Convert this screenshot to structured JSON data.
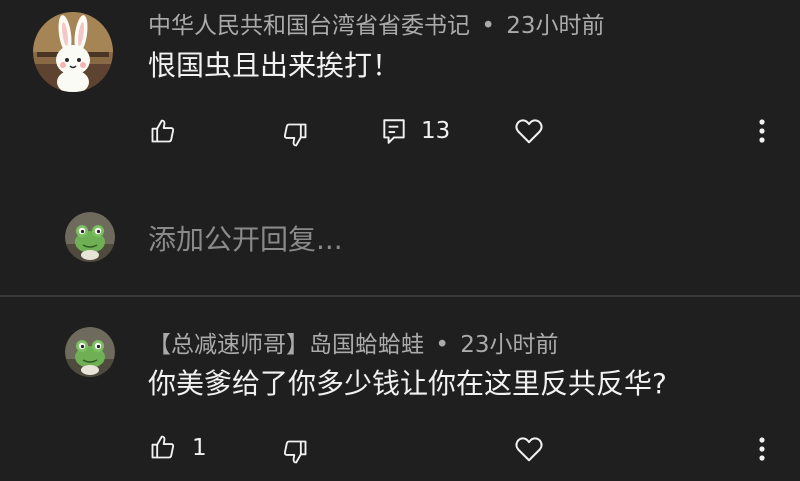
{
  "comments": [
    {
      "author": "中华人民共和国台湾省省委书记",
      "separator": "•",
      "time": "23小时前",
      "text": "恨国虫且出来挨打！",
      "reply_count": "13",
      "avatar_icon": "bunny-avatar-icon"
    },
    {
      "author": "【总减速师哥】岛国蛤蛤蛙",
      "separator": "•",
      "time": "23小时前",
      "text": "你美爹给了你多少钱让你在这里反共反华?",
      "like_count": "1",
      "avatar_icon": "frog-avatar-icon"
    }
  ],
  "reply_box": {
    "placeholder": "添加公开回复...",
    "avatar_icon": "frog-avatar-icon"
  },
  "icons": {
    "like": "thumbs-up-icon",
    "dislike": "thumbs-down-icon",
    "reply": "reply-comment-icon",
    "heart": "heart-icon",
    "more": "more-vertical-icon"
  },
  "colors": {
    "background": "#1f1f1f",
    "text_primary": "#f1f1f1",
    "text_secondary": "#aaaaaa",
    "placeholder": "#8a8a8a",
    "divider": "#3a3a3a"
  }
}
